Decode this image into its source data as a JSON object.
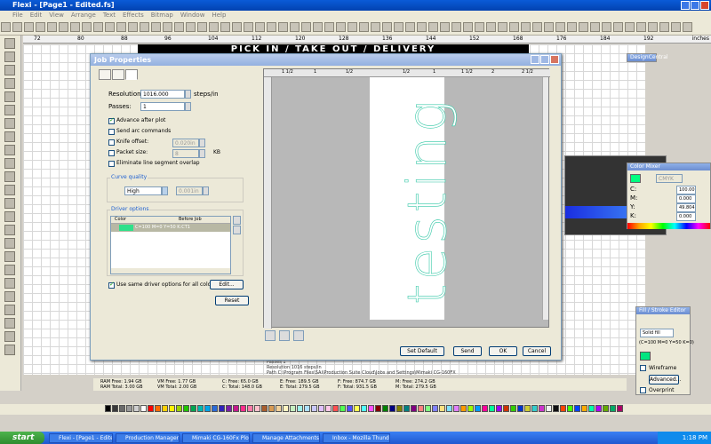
{
  "app": {
    "title": "Flexi - [Page1 - Edited.fs]"
  },
  "menu": [
    "File",
    "Edit",
    "View",
    "Arrange",
    "Text",
    "Effects",
    "Bitmap",
    "Window",
    "Help"
  ],
  "ruler": {
    "marks": [
      "72",
      "80",
      "88",
      "96",
      "104",
      "112",
      "120",
      "128",
      "136",
      "144",
      "152",
      "168",
      "176",
      "184",
      "192"
    ],
    "unit": "inches"
  },
  "banner_text": "PICK IN / TAKE OUT / DELIVERY",
  "dialog": {
    "title": "Job Properties",
    "resolution_label": "Resolution:",
    "resolution_value": "1016.000",
    "resolution_unit": "steps/in",
    "passes_label": "Passes:",
    "passes_value": "1",
    "advance_label": "Advance after plot",
    "send_arc_label": "Send arc commands",
    "knife_offset_label": "Knife offset:",
    "knife_offset_value": "0.020in",
    "packet_size_label": "Packet size:",
    "packet_size_value": "8",
    "packet_unit": "KB",
    "eliminate_label": "Eliminate line segment overlap",
    "curve_quality_label": "Curve quality",
    "curve_quality_value": "High",
    "curve_quality_extra": "0.001in",
    "driver_options_label": "Driver options",
    "col_color": "Color",
    "col_before": "Before Job",
    "driver_row": "C=100 M=0 Y=50 K:CT1",
    "use_same_label": "Use same driver options for all colors",
    "edit_btn": "Edit...",
    "reset_btn": "Reset",
    "set_default_btn": "Set Default",
    "send_btn": "Send",
    "ok_btn": "OK",
    "cancel_btn": "Cancel",
    "preview_text": "testing",
    "preview_ruler": [
      "1 1/2",
      "1",
      "1/2",
      "1/2",
      "1",
      "1 1/2",
      "2",
      "2 1/2"
    ]
  },
  "right": {
    "design_central": "DesignCentral",
    "color_mixer": "Color Mixer",
    "cmyk": "CMYK",
    "c_label": "C:",
    "c_value": "100.00",
    "m_label": "M:",
    "m_value": "0.000",
    "y_label": "Y:",
    "y_value": "49.804",
    "k_label": "K:",
    "k_value": "0.000",
    "fill_title": "Fill / Stroke Editor",
    "fill_type": "Solid fill",
    "fill_desc": "(C=100 M=0 Y=50 K=0)",
    "wireframe": "Wireframe",
    "advanced": "Advanced...",
    "overprint": "Overprint"
  },
  "behind": {
    "passes": "Passes  1",
    "resolution": "Resolution  1016 steps/in",
    "path": "Path  C:\\Program Files\\SAi\\Production Suite Cloud\\Jobs and Settings\\Mimaki CG-160FX"
  },
  "status": {
    "ram_free": "RAM Free: 1.94 GB",
    "ram_total": "RAM Total: 3.00 GB",
    "vm_free": "VM Free: 1.77 GB",
    "vm_total": "VM Total: 2.00 GB",
    "c_free": "C: Free: 65.0 GB",
    "c_total": "C: Total: 148.0 GB",
    "e_free": "E: Free: 189.5 GB",
    "e_total": "E: Total: 279.5 GB",
    "f_free": "F: Free: 874.7 GB",
    "f_total": "F: Total: 931.5 GB",
    "m_free": "M: Free: 274.2 GB",
    "m_total": "M: Total: 279.5 GB"
  },
  "palette": [
    "#000000",
    "#3a3a3a",
    "#6a6a6a",
    "#9a9a9a",
    "#cfcfcf",
    "#ffffff",
    "#ff0000",
    "#ff6a00",
    "#ffd000",
    "#fff200",
    "#9bd000",
    "#21c400",
    "#00a550",
    "#00b8b0",
    "#00a3e8",
    "#2a6ad8",
    "#3023b8",
    "#7a1fa8",
    "#c41a8c",
    "#ff2d8a",
    "#ff7aa8",
    "#ffc0cb",
    "#a85d2d",
    "#d89a52",
    "#f2d19a",
    "#fff4c1",
    "#c6f0c0",
    "#9ef0e8",
    "#aee0ff",
    "#c8c8ff",
    "#e0c0ff",
    "#ffc8e8",
    "#ff5050",
    "#50ff50",
    "#5050ff",
    "#ffff50",
    "#50ffff",
    "#ff50ff",
    "#800000",
    "#008000",
    "#000080",
    "#808000",
    "#008080",
    "#800080",
    "#ff8080",
    "#80ff80",
    "#8080ff",
    "#ffe080",
    "#80e0ff",
    "#e080ff",
    "#ff9900",
    "#99ff00",
    "#0099ff",
    "#ff0099",
    "#00ff99",
    "#9900ff",
    "#cc3300",
    "#33cc00",
    "#0033cc",
    "#cccc33",
    "#33cccc",
    "#cc33cc",
    "#f0f0f0",
    "#101010",
    "#ff4400",
    "#44ff00",
    "#0044ff",
    "#ffaa00",
    "#00ffaa",
    "#aa00ff",
    "#66aa00",
    "#00aa66",
    "#aa0066"
  ],
  "taskbar": {
    "start": "start",
    "tasks": [
      "Flexi - [Page1 - Edite...",
      "Production Manager",
      "Mimaki CG-160Fx Plot...",
      "Manage Attachments...",
      "Inbox - Mozilla Thund..."
    ],
    "clock": "1:18 PM"
  }
}
